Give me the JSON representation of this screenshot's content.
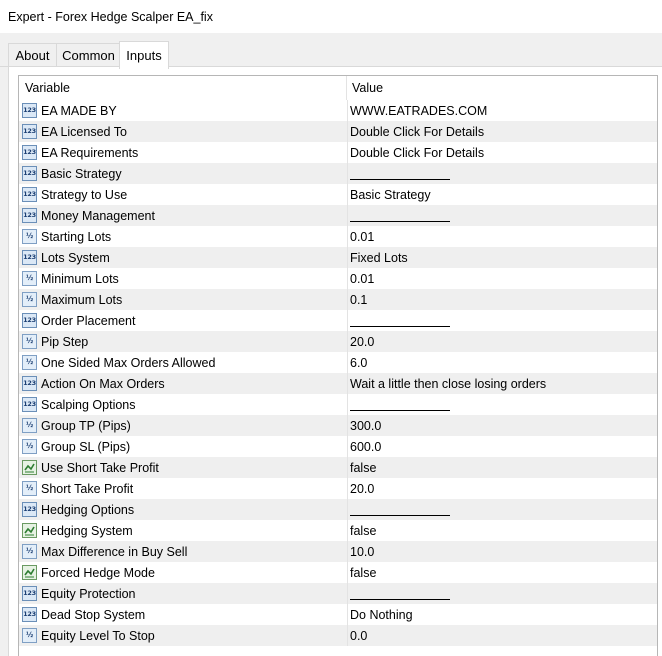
{
  "window": {
    "title": "Expert - Forex Hedge Scalper EA_fix"
  },
  "tabs": [
    {
      "label": "About"
    },
    {
      "label": "Common"
    },
    {
      "label": "Inputs"
    }
  ],
  "table": {
    "headers": {
      "variable": "Variable",
      "value": "Value"
    },
    "rows": [
      {
        "icon": "int-123-icon",
        "variable": "EA MADE BY",
        "value": "WWW.EATRADES.COM"
      },
      {
        "icon": "int-123-icon",
        "variable": "EA Licensed To",
        "value": "Double Click For Details"
      },
      {
        "icon": "int-123-icon",
        "variable": "EA Requirements",
        "value": "Double Click For Details"
      },
      {
        "icon": "int-123-icon",
        "variable": "Basic Strategy",
        "value": ""
      },
      {
        "icon": "int-123-icon",
        "variable": "Strategy to Use",
        "value": "Basic Strategy"
      },
      {
        "icon": "int-123-icon",
        "variable": "Money Management",
        "value": ""
      },
      {
        "icon": "double-icon",
        "variable": "Starting Lots",
        "value": "0.01"
      },
      {
        "icon": "int-123-icon",
        "variable": "Lots System",
        "value": "Fixed Lots"
      },
      {
        "icon": "double-icon",
        "variable": "Minimum Lots",
        "value": "0.01"
      },
      {
        "icon": "double-icon",
        "variable": "Maximum Lots",
        "value": "0.1"
      },
      {
        "icon": "int-123-icon",
        "variable": "Order Placement",
        "value": ""
      },
      {
        "icon": "double-icon",
        "variable": "Pip Step",
        "value": "20.0"
      },
      {
        "icon": "double-icon",
        "variable": "One Sided Max Orders Allowed",
        "value": "6.0"
      },
      {
        "icon": "int-123-icon",
        "variable": "Action On Max Orders",
        "value": "Wait a little then close losing orders"
      },
      {
        "icon": "int-123-icon",
        "variable": "Scalping Options",
        "value": ""
      },
      {
        "icon": "double-icon",
        "variable": "Group TP (Pips)",
        "value": "300.0"
      },
      {
        "icon": "double-icon",
        "variable": "Group SL (Pips)",
        "value": "600.0"
      },
      {
        "icon": "bool-icon",
        "variable": "Use Short Take Profit",
        "value": "false"
      },
      {
        "icon": "double-icon",
        "variable": "Short Take Profit",
        "value": "20.0"
      },
      {
        "icon": "int-123-icon",
        "variable": "Hedging Options",
        "value": ""
      },
      {
        "icon": "bool-icon",
        "variable": "Hedging System",
        "value": "false"
      },
      {
        "icon": "double-icon",
        "variable": "Max Difference in Buy Sell",
        "value": "10.0"
      },
      {
        "icon": "bool-icon",
        "variable": "Forced Hedge Mode",
        "value": "false"
      },
      {
        "icon": "int-123-icon",
        "variable": "Equity Protection",
        "value": ""
      },
      {
        "icon": "int-123-icon",
        "variable": "Dead Stop System",
        "value": "Do Nothing"
      },
      {
        "icon": "double-icon",
        "variable": "Equity Level To Stop",
        "value": "0.0"
      }
    ]
  },
  "icon_glyphs": {
    "int-123-icon": "123",
    "double-icon": "½"
  },
  "colors": {
    "alt_row": "#efefef",
    "window_bg": "#f0f0f0",
    "panel_bg": "#ffffff"
  }
}
